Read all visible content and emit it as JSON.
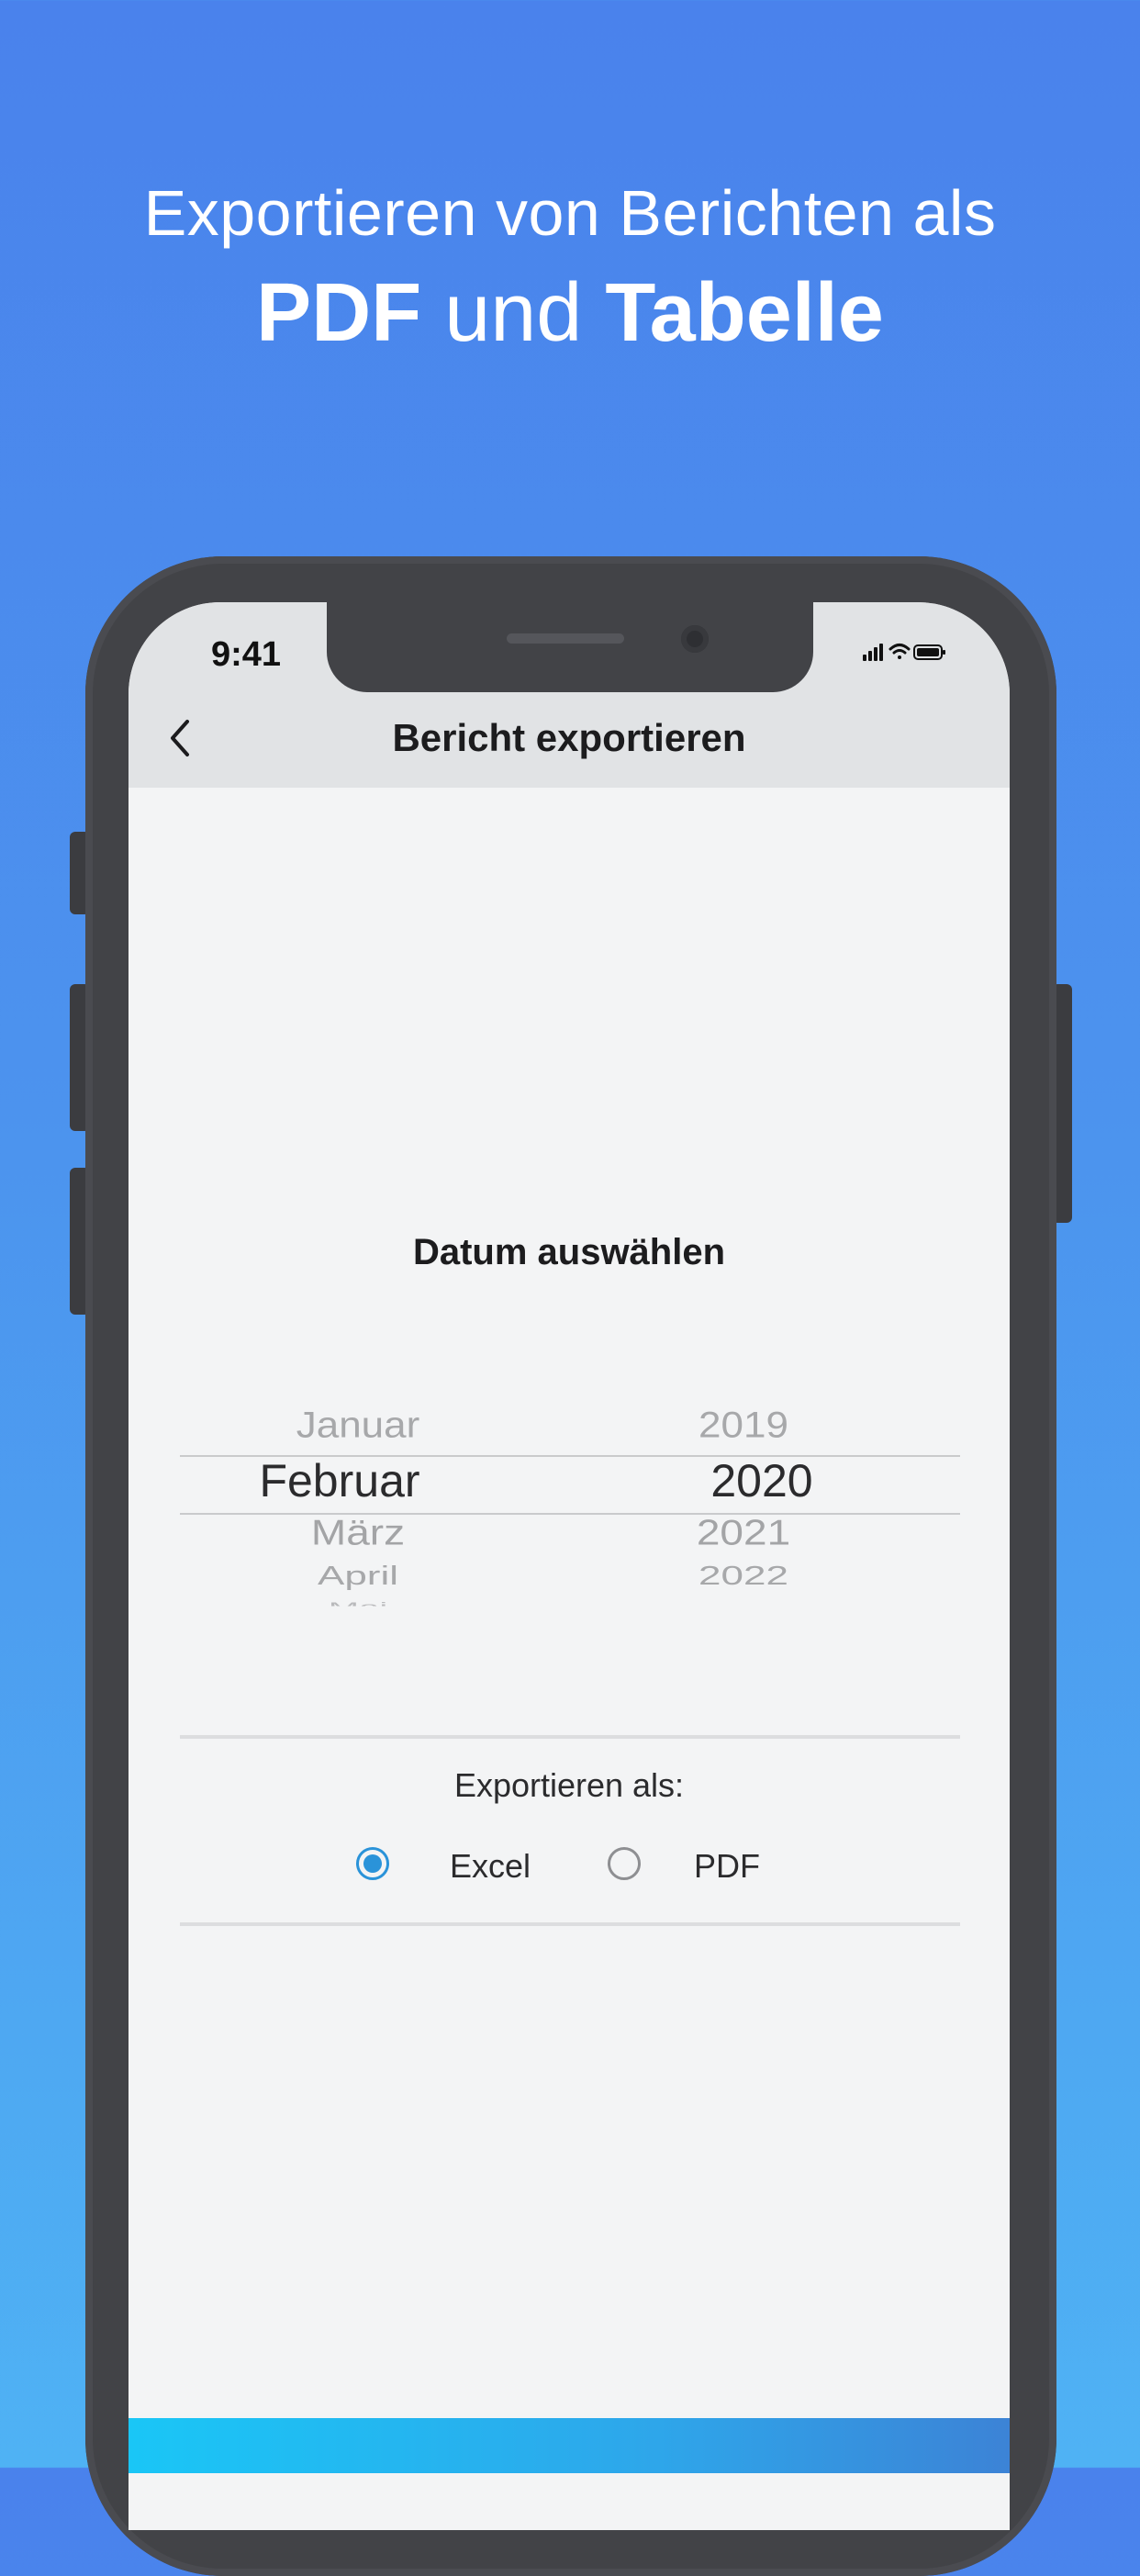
{
  "headline": {
    "line1": "Exportieren von Berichten als",
    "pdf": "PDF",
    "und": "und",
    "tabelle": "Tabelle"
  },
  "status_bar": {
    "time": "9:41",
    "icons": [
      "signal-icon",
      "wifi-icon",
      "battery-icon"
    ]
  },
  "nav": {
    "back_icon": "chevron-left-icon",
    "title": "Bericht exportieren"
  },
  "date_picker": {
    "title": "Datum auswählen",
    "months": [
      "Januar",
      "Februar",
      "März",
      "April",
      "Mai"
    ],
    "years": [
      "2019",
      "2020",
      "2021",
      "2022"
    ],
    "selected_month": "Februar",
    "selected_year": "2020"
  },
  "export": {
    "label": "Exportieren als:",
    "options": [
      {
        "label": "Excel",
        "selected": true
      },
      {
        "label": "PDF",
        "selected": false
      }
    ]
  },
  "colors": {
    "accent": "#2a93d9",
    "background_top": "#4a82ec",
    "background_bottom": "#4fb2f4"
  }
}
